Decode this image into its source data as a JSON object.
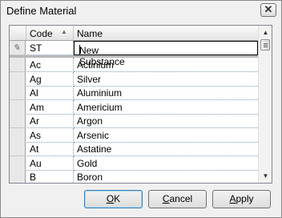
{
  "window": {
    "title": "Define Material",
    "close_label": "✕"
  },
  "grid": {
    "columns": [
      {
        "label": "Code"
      },
      {
        "label": "Name"
      }
    ],
    "new_row": {
      "code": "ST",
      "name": "New Substance"
    },
    "rows": [
      {
        "code": "Ac",
        "name": "Actinium"
      },
      {
        "code": "Ag",
        "name": "Silver"
      },
      {
        "code": "Al",
        "name": "Aluminium"
      },
      {
        "code": "Am",
        "name": "Americium"
      },
      {
        "code": "Ar",
        "name": "Argon"
      },
      {
        "code": "As",
        "name": "Arsenic"
      },
      {
        "code": "At",
        "name": "Astatine"
      },
      {
        "code": "Au",
        "name": "Gold"
      },
      {
        "code": "B",
        "name": "Boron"
      }
    ]
  },
  "buttons": {
    "ok": {
      "mnemonic": "O",
      "rest": "K"
    },
    "cancel": {
      "mnemonic": "C",
      "rest": "ancel"
    },
    "apply": {
      "mnemonic": "A",
      "rest": "pply"
    }
  }
}
